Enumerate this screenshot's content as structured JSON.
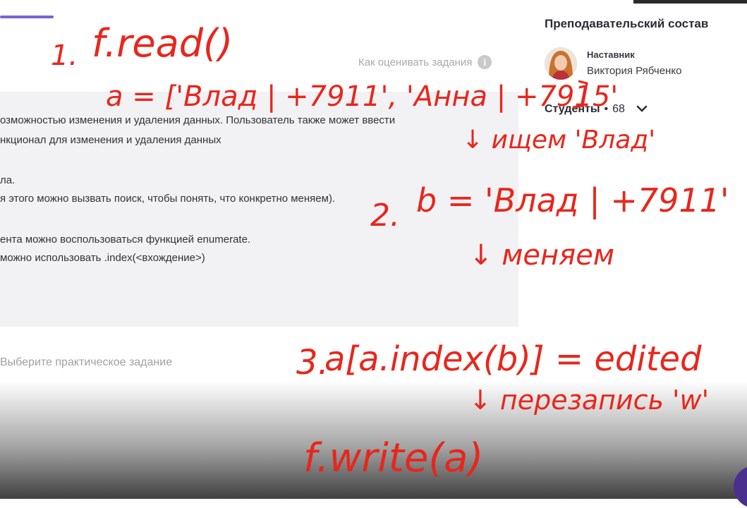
{
  "task": {
    "how_to_grade": "Как оценивать задания",
    "lines": [
      "озможностью изменения и удаления данных. Пользователь также может ввести",
      "нкционал для изменения и удаления данных",
      "ла.",
      "я этого можно вызвать поиск, чтобы понять, что конкретно меняем).",
      "ента можно воспользоваться функцией enumerate.",
      "можно использовать .index(<вхождение>)"
    ],
    "select_practical": "Выберите практическое задание"
  },
  "sidebar": {
    "teachers_title": "Преподавательский состав",
    "mentor_role": "Наставник",
    "mentor_name": "Виктория Рябченко",
    "students_label": "Студенты",
    "students_count": "68"
  },
  "annotations": {
    "step1": "1.",
    "read_call": "f.read()",
    "list_literal": "a = ['Влад | +7911', 'Анна | +7915'",
    "search_note": "↓ ищем 'Влад'",
    "step2": "2.",
    "b_assign": "b = 'Влад | +7911'",
    "change_note": "↓ меняем",
    "step3": "3.",
    "edit_expr": "a[a.index(b)] = edited",
    "rewrite_note": "↓ перезапись 'w'",
    "write_call": "f.write(a)"
  },
  "colors": {
    "ink": "#e8261c",
    "accent": "#7b61d6",
    "task_bg": "#f2f2f5"
  },
  "icons": {
    "info": "info-icon",
    "chevron": "chevron-down-icon",
    "avatar": "avatar"
  }
}
